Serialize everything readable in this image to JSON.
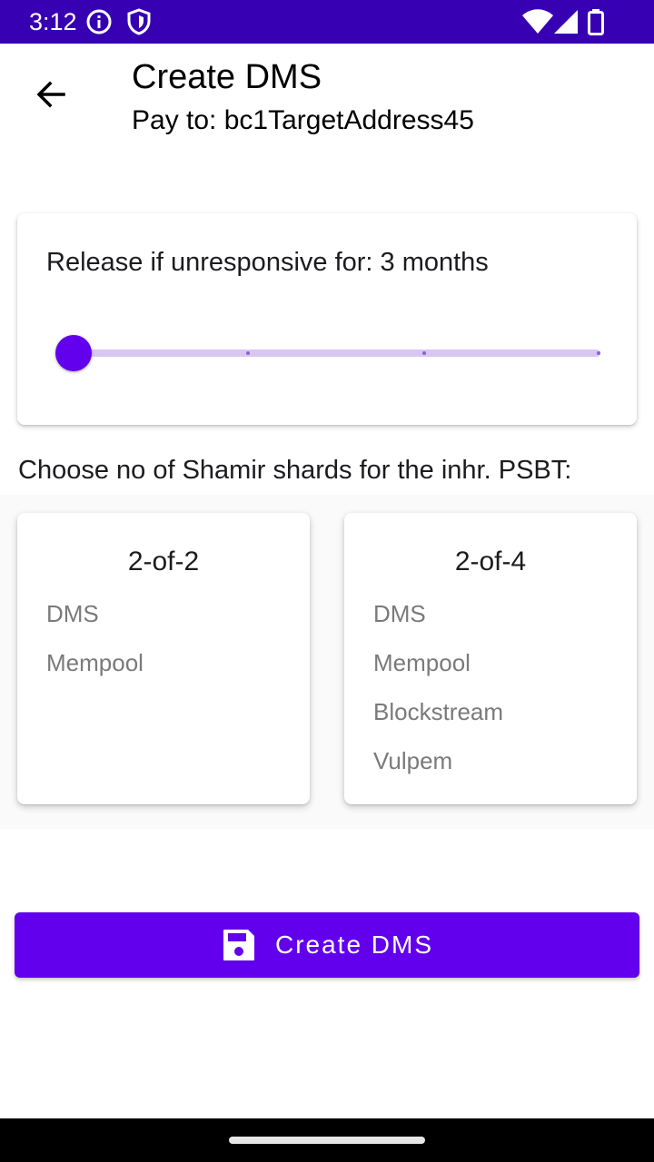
{
  "status_bar": {
    "time": "3:12",
    "icons": [
      "info-icon",
      "shield-icon",
      "wifi-icon",
      "signal-icon",
      "battery-icon"
    ]
  },
  "app_bar": {
    "back_icon": "arrow-back-icon",
    "title": "Create DMS",
    "subtitle": "Pay to: bc1TargetAddress45"
  },
  "release_slider": {
    "label": "Release if unresponsive for: 3 months",
    "value_fraction": 0.0,
    "tick_fractions": [
      0.333,
      0.667,
      1.0
    ]
  },
  "shards": {
    "heading": "Choose no of Shamir shards for the inhr. PSBT:",
    "options": [
      {
        "title": "2-of-2",
        "items": [
          "DMS",
          "Mempool"
        ]
      },
      {
        "title": "2-of-4",
        "items": [
          "DMS",
          "Mempool",
          "Blockstream",
          "Vulpem"
        ]
      }
    ]
  },
  "create_button": {
    "icon": "save-icon",
    "label": "Create DMS"
  },
  "colors": {
    "status_bar": "#3700b3",
    "accent": "#6200ee",
    "slider_track": "#d8c6f4",
    "secondary_text": "#7a7a7a"
  }
}
